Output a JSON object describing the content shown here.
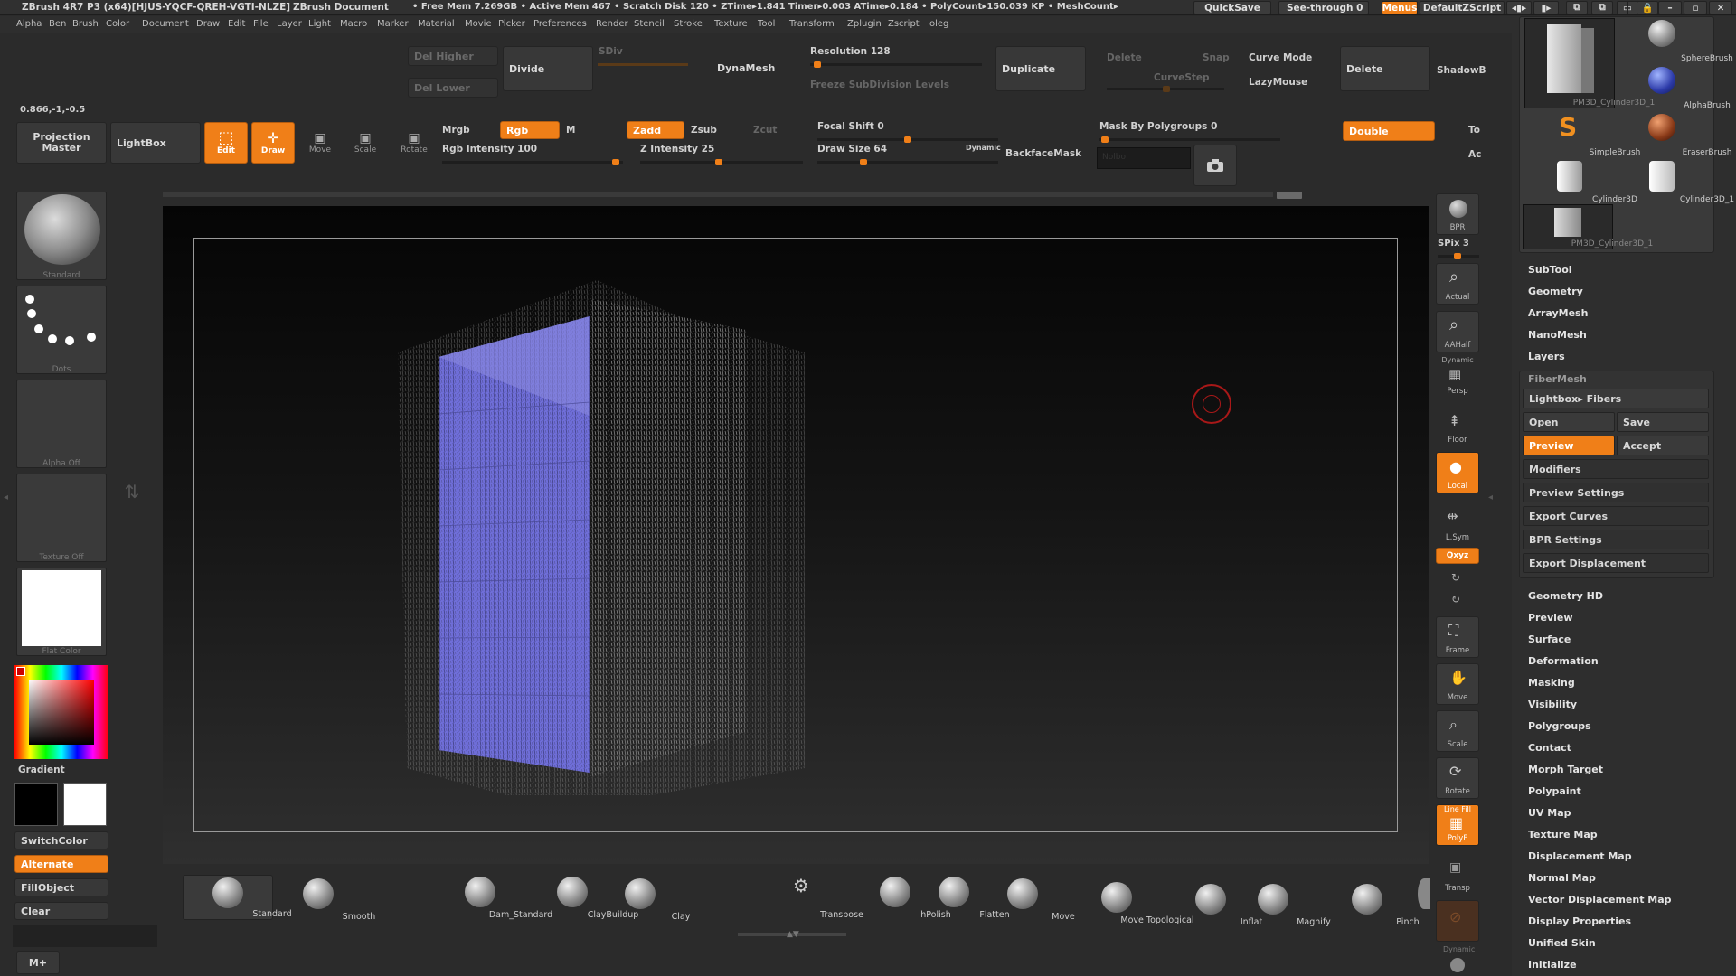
{
  "titlebar": {
    "app": "ZBrush 4R7 P3 (x64)[HJUS-YQCF-QREH-VGTI-NLZE]",
    "doc": "ZBrush Document",
    "stats": "• Free Mem 7.269GB • Active Mem 467 • Scratch Disk 120 • ZTime▸1.841 Timer▸0.003 ATime▸0.184 • PolyCount▸150.039 KP • MeshCount▸",
    "quicksave": "QuickSave",
    "seethrough": "See-through 0",
    "menus": "Menus",
    "script": "DefaultZScript"
  },
  "menubar": [
    "Alpha",
    "Ben",
    "Brush",
    "Color",
    "Document",
    "Draw",
    "Edit",
    "File",
    "Layer",
    "Light",
    "Macro",
    "Marker",
    "Material",
    "Movie",
    "Picker",
    "Preferences",
    "Render",
    "Stencil",
    "Stroke",
    "Texture",
    "Tool",
    "Transform",
    "Zplugin",
    "Zscript",
    "oleg"
  ],
  "toolbar1": {
    "del_higher": "Del Higher",
    "del_lower": "Del Lower",
    "divide": "Divide",
    "sdiv": "SDiv",
    "dynamesh": "DynaMesh",
    "resolution": "Resolution 128",
    "freeze": "Freeze SubDivision Levels",
    "duplicate": "Duplicate",
    "delete_dim": "Delete",
    "snap": "Snap",
    "curvestep": "CurveStep",
    "curve_mode": "Curve Mode",
    "lazymouse": "LazyMouse",
    "delete": "Delete",
    "shadowbox": "ShadowB"
  },
  "coords": "0.866,-1,-0.5",
  "toolbar2": {
    "projection_master": "Projection Master",
    "lightbox": "LightBox",
    "edit": "Edit",
    "draw": "Draw",
    "move": "Move",
    "scale": "Scale",
    "rotate": "Rotate",
    "mrgb": "Mrgb",
    "rgb": "Rgb",
    "m": "M",
    "zadd": "Zadd",
    "zsub": "Zsub",
    "zcut": "Zcut",
    "rgb_intensity": "Rgb Intensity 100",
    "z_intensity": "Z Intensity 25",
    "focal_shift": "Focal Shift 0",
    "draw_size": "Draw Size 64",
    "dynamic": "Dynamic",
    "backface": "BackfaceMask",
    "mask_polygroups": "Mask By Polygroups 0",
    "double": "Double",
    "to": "To",
    "ac": "Ac",
    "material_placeholder": "Nolbo"
  },
  "left_shelf": {
    "standard": "Standard",
    "dots": "Dots",
    "alpha_off": "Alpha Off",
    "texture_off": "Texture Off",
    "flat_color": "Flat Color",
    "gradient": "Gradient",
    "switchcolor": "SwitchColor",
    "alternate": "Alternate",
    "fillobject": "FillObject",
    "clear": "Clear",
    "mplus": "M+"
  },
  "right_tools": {
    "bpr": "BPR",
    "spix": "SPix 3",
    "actual": "Actual",
    "aahalf": "AAHalf",
    "dynamic": "Dynamic",
    "persp": "Persp",
    "floor": "Floor",
    "local": "Local",
    "lsym": "L.Sym",
    "xyz": "Qxyz",
    "frame": "Frame",
    "move": "Move",
    "scale": "Scale",
    "rotate": "Rotate",
    "linefill": "Line Fill",
    "polyf": "PolyF",
    "transp": "Transp",
    "dynamic2": "Dynamic"
  },
  "tool_thumbs": [
    "PM3D_Cylinder3D_1",
    "SphereBrush",
    "AlphaBrush",
    "SimpleBrush",
    "EraserBrush",
    "Cylinder3D",
    "Cylinder3D_1",
    "PM3D_Cylinder3D_1"
  ],
  "tool_menu": {
    "top": [
      "SubTool",
      "Geometry",
      "ArrayMesh",
      "NanoMesh",
      "Layers"
    ],
    "fibermesh": "FiberMesh",
    "lightbox_fibers": "Lightbox▸ Fibers",
    "open": "Open",
    "save": "Save",
    "preview": "Preview",
    "accept": "Accept",
    "sub": [
      "Modifiers",
      "Preview Settings",
      "Export Curves",
      "BPR Settings",
      "Export Displacement"
    ],
    "bottom": [
      "Geometry HD",
      "Preview",
      "Surface",
      "Deformation",
      "Masking",
      "Visibility",
      "Polygroups",
      "Contact",
      "Morph Target",
      "Polypaint",
      "UV Map",
      "Texture Map",
      "Displacement Map",
      "Normal Map",
      "Vector Displacement Map",
      "Display Properties",
      "Unified Skin",
      "Initialize"
    ]
  },
  "bottom_brushes": [
    "Standard",
    "Smooth",
    "Dam_Standard",
    "ClayBuildup",
    "Clay",
    "Transpose",
    "hPolish",
    "Flatten",
    "Move",
    "Move Topological",
    "Inflat",
    "Magnify",
    "Pinch"
  ],
  "colors": {
    "accent": "#f07f18",
    "viewport_bg": "#0a0a0a",
    "mesh": "#6f6ed8"
  }
}
